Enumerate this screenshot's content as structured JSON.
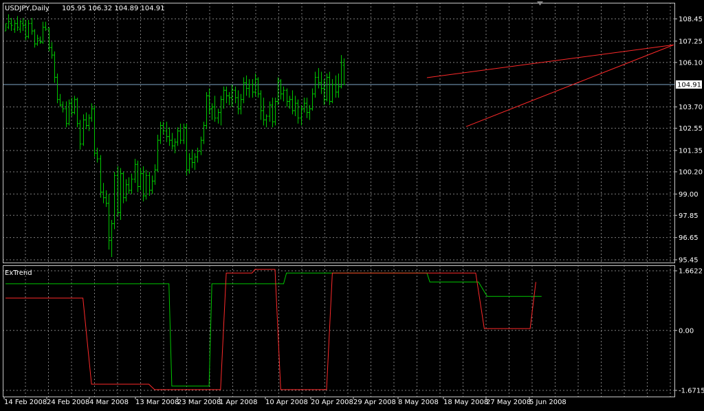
{
  "colors": {
    "background": "#000000",
    "grid": "#7f7f7f",
    "frame": "#c8c8c8",
    "text": "#ffffff",
    "bar": "#00c800",
    "trendline": "#ff2a2a",
    "price_line": "#7ea6c6",
    "extrend_up": "#00c800",
    "extrend_down": "#ff2a2a"
  },
  "header": {
    "symbol": "USDJPY,Daily",
    "ohlc": "105.95 106.32 104.89 104.91"
  },
  "chart_data": [
    {
      "type": "ohlc",
      "y_ticks": [
        "108.45",
        "107.25",
        "106.10",
        "104.91",
        "103.70",
        "102.55",
        "101.35",
        "100.20",
        "99.00",
        "97.85",
        "96.65",
        "95.45"
      ],
      "x_ticks": [
        "14 Feb 2008",
        "24 Feb 2008",
        "4 Mar 2008",
        "13 Mar 2008",
        "23 Mar 2008",
        "1 Apr 2008",
        "10 Apr 2008",
        "20 Apr 2008",
        "29 Apr 2008",
        "8 May 2008",
        "18 May 2008",
        "27 May 2008",
        "5 Jun 2008"
      ],
      "ylim": [
        95.45,
        109.1
      ],
      "current_price": 104.91,
      "grid": true,
      "bars": [
        [
          107.8,
          108.2,
          107.8,
          108.2
        ],
        [
          108.0,
          108.7,
          107.9,
          108.3
        ],
        [
          108.2,
          108.5,
          107.8,
          108.1
        ],
        [
          107.9,
          108.4,
          107.7,
          108.2
        ],
        [
          108.2,
          108.6,
          107.8,
          108.0
        ],
        [
          107.9,
          108.4,
          107.7,
          108.3
        ],
        [
          108.2,
          108.5,
          107.8,
          108.1
        ],
        [
          108.1,
          108.4,
          107.3,
          107.5
        ],
        [
          107.5,
          108.4,
          107.4,
          108.2
        ],
        [
          108.2,
          108.5,
          107.6,
          107.8
        ],
        [
          107.8,
          107.9,
          106.9,
          107.1
        ],
        [
          107.1,
          107.6,
          107.0,
          107.4
        ],
        [
          107.3,
          107.5,
          107.1,
          107.2
        ],
        [
          107.2,
          108.3,
          107.1,
          108.0
        ],
        [
          108.0,
          108.3,
          107.8,
          107.9
        ],
        [
          107.9,
          108.0,
          106.7,
          106.9
        ],
        [
          106.9,
          107.2,
          106.3,
          106.5
        ],
        [
          106.5,
          106.7,
          105.0,
          105.3
        ],
        [
          105.3,
          105.5,
          103.9,
          104.1
        ],
        [
          104.1,
          104.4,
          103.7,
          103.8
        ],
        [
          103.8,
          104.0,
          103.4,
          103.6
        ],
        [
          103.6,
          104.0,
          102.6,
          102.8
        ],
        [
          102.8,
          104.1,
          102.7,
          103.9
        ],
        [
          103.9,
          104.2,
          103.2,
          103.4
        ],
        [
          103.4,
          104.3,
          103.3,
          104.1
        ],
        [
          104.1,
          104.2,
          102.6,
          102.8
        ],
        [
          102.8,
          103.0,
          101.4,
          101.7
        ],
        [
          101.7,
          103.3,
          101.6,
          103.0
        ],
        [
          103.0,
          103.4,
          102.5,
          102.7
        ],
        [
          102.7,
          103.3,
          102.4,
          103.1
        ],
        [
          103.1,
          103.9,
          102.9,
          103.6
        ],
        [
          103.6,
          103.8,
          101.0,
          101.2
        ],
        [
          101.2,
          101.5,
          100.7,
          100.9
        ],
        [
          100.9,
          101.1,
          98.8,
          99.1
        ],
        [
          99.1,
          99.6,
          98.5,
          98.8
        ],
        [
          98.8,
          99.2,
          98.3,
          98.5
        ],
        [
          98.5,
          99.0,
          96.0,
          96.5
        ],
        [
          96.5,
          97.6,
          95.6,
          97.4
        ],
        [
          97.4,
          100.2,
          97.1,
          100.0
        ],
        [
          100.0,
          100.5,
          97.8,
          98.0
        ],
        [
          98.0,
          100.4,
          97.6,
          100.1
        ],
        [
          100.1,
          100.2,
          98.5,
          98.8
        ],
        [
          98.8,
          99.8,
          98.6,
          99.5
        ],
        [
          99.5,
          99.9,
          99.0,
          99.2
        ],
        [
          99.2,
          100.1,
          99.0,
          99.8
        ],
        [
          99.8,
          100.9,
          99.6,
          100.6
        ],
        [
          100.6,
          100.8,
          99.1,
          99.4
        ],
        [
          99.4,
          100.4,
          99.2,
          100.1
        ],
        [
          100.1,
          100.5,
          98.6,
          98.9
        ],
        [
          98.9,
          100.3,
          98.7,
          100.0
        ],
        [
          100.0,
          100.2,
          98.9,
          99.2
        ],
        [
          99.2,
          100.0,
          99.0,
          99.7
        ],
        [
          99.7,
          100.6,
          99.5,
          100.3
        ],
        [
          100.3,
          102.2,
          100.2,
          101.9
        ],
        [
          101.9,
          102.9,
          101.7,
          102.7
        ],
        [
          102.7,
          102.9,
          102.2,
          102.4
        ],
        [
          102.4,
          102.9,
          101.8,
          102.1
        ],
        [
          102.1,
          102.6,
          101.6,
          101.9
        ],
        [
          101.9,
          102.3,
          101.4,
          101.6
        ],
        [
          101.6,
          102.0,
          101.2,
          101.8
        ],
        [
          101.8,
          102.6,
          101.6,
          102.4
        ],
        [
          102.4,
          102.8,
          101.7,
          101.9
        ],
        [
          101.9,
          102.8,
          101.7,
          102.6
        ],
        [
          102.6,
          102.8,
          100.0,
          100.3
        ],
        [
          100.3,
          101.2,
          100.1,
          100.9
        ],
        [
          100.9,
          101.4,
          100.4,
          100.7
        ],
        [
          100.7,
          101.2,
          100.3,
          101.0
        ],
        [
          101.0,
          101.5,
          100.7,
          101.3
        ],
        [
          101.3,
          102.1,
          101.1,
          101.9
        ],
        [
          101.9,
          102.9,
          101.7,
          102.7
        ],
        [
          102.7,
          104.5,
          102.5,
          104.3
        ],
        [
          104.3,
          104.7,
          103.3,
          103.6
        ],
        [
          103.6,
          103.9,
          103.0,
          103.7
        ],
        [
          103.7,
          104.3,
          102.9,
          103.1
        ],
        [
          103.1,
          103.6,
          102.8,
          103.4
        ],
        [
          103.4,
          104.3,
          102.7,
          104.1
        ],
        [
          104.1,
          104.8,
          103.6,
          104.6
        ],
        [
          104.6,
          104.8,
          103.9,
          104.3
        ],
        [
          104.3,
          104.5,
          103.8,
          104.2
        ],
        [
          104.2,
          104.9,
          103.7,
          104.6
        ],
        [
          104.6,
          104.8,
          103.9,
          104.2
        ],
        [
          104.2,
          104.6,
          103.3,
          103.6
        ],
        [
          103.6,
          104.4,
          103.3,
          104.1
        ],
        [
          104.1,
          105.3,
          103.9,
          105.0
        ],
        [
          105.0,
          105.4,
          104.3,
          104.7
        ],
        [
          104.7,
          105.2,
          104.2,
          104.9
        ],
        [
          104.9,
          105.2,
          104.2,
          104.5
        ],
        [
          104.5,
          105.5,
          104.3,
          105.2
        ],
        [
          105.2,
          105.3,
          104.2,
          104.4
        ],
        [
          104.4,
          104.6,
          103.0,
          103.5
        ],
        [
          103.5,
          104.2,
          102.7,
          103.0
        ],
        [
          103.0,
          103.3,
          102.6,
          103.2
        ],
        [
          103.2,
          104.0,
          102.9,
          103.8
        ],
        [
          103.8,
          104.2,
          102.6,
          102.9
        ],
        [
          102.9,
          104.2,
          102.7,
          104.0
        ],
        [
          104.0,
          105.3,
          103.8,
          105.1
        ],
        [
          105.1,
          105.2,
          104.1,
          104.4
        ],
        [
          104.4,
          104.8,
          104.0,
          104.6
        ],
        [
          104.6,
          104.7,
          103.7,
          104.0
        ],
        [
          104.0,
          104.3,
          103.6,
          104.1
        ],
        [
          104.1,
          104.6,
          103.3,
          103.5
        ],
        [
          103.5,
          104.3,
          103.2,
          103.9
        ],
        [
          103.9,
          104.1,
          102.8,
          103.1
        ],
        [
          103.1,
          103.8,
          102.7,
          103.6
        ],
        [
          103.6,
          104.2,
          103.4,
          103.9
        ],
        [
          103.9,
          104.2,
          103.1,
          103.4
        ],
        [
          103.4,
          103.8,
          103.0,
          103.6
        ],
        [
          103.6,
          104.7,
          103.5,
          104.4
        ],
        [
          104.4,
          105.6,
          104.2,
          105.3
        ],
        [
          105.3,
          105.8,
          104.7,
          105.0
        ],
        [
          105.0,
          105.6,
          104.4,
          104.7
        ],
        [
          104.7,
          105.2,
          103.8,
          104.1
        ],
        [
          104.1,
          105.5,
          104.0,
          105.3
        ],
        [
          105.3,
          105.6,
          103.8,
          104.0
        ],
        [
          104.0,
          105.2,
          103.9,
          104.9
        ],
        [
          104.9,
          105.4,
          104.2,
          104.5
        ],
        [
          104.5,
          105.5,
          104.2,
          104.8
        ],
        [
          104.8,
          106.5,
          104.7,
          106.1
        ],
        [
          105.95,
          106.32,
          104.89,
          104.91
        ]
      ],
      "trendlines": [
        [
          [
            0,
            105.28
          ],
          [
            1,
            107.05
          ]
        ],
        [
          [
            0,
            102.64
          ],
          [
            1,
            107.05
          ]
        ]
      ]
    },
    {
      "type": "line",
      "title": "ExTrend",
      "y_ticks": [
        "1.6622",
        "0.00",
        "-1.6715"
      ],
      "ylim": [
        -1.6715,
        1.6622
      ],
      "grid": true,
      "series": [
        {
          "points": [
            [
              0,
              1.3
            ],
            [
              35,
              1.3
            ],
            [
              57,
              1.3
            ],
            [
              58,
              -1.55
            ],
            [
              71,
              -1.55
            ],
            [
              72,
              1.3
            ],
            [
              97,
              1.3
            ],
            [
              98,
              1.6
            ],
            [
              117,
              1.6
            ],
            [
              118,
              1.6
            ],
            [
              147,
              1.6
            ],
            [
              148,
              1.35
            ],
            [
              165,
              1.35
            ],
            [
              168,
              0.95
            ],
            [
              187,
              0.95
            ]
          ]
        },
        {
          "points": [
            [
              0,
              0.9
            ],
            [
              27,
              0.9
            ],
            [
              30,
              -1.5
            ],
            [
              50,
              -1.5
            ],
            [
              52,
              -1.65
            ],
            [
              75,
              -1.65
            ],
            [
              77,
              1.6
            ],
            [
              86,
              1.6
            ],
            [
              87,
              1.7
            ],
            [
              94,
              1.7
            ],
            [
              96,
              -1.65
            ],
            [
              112,
              -1.65
            ],
            [
              114,
              1.6
            ],
            [
              164,
              1.6
            ],
            [
              167,
              0.05
            ],
            [
              183,
              0.05
            ],
            [
              185,
              1.35
            ]
          ]
        }
      ]
    }
  ]
}
